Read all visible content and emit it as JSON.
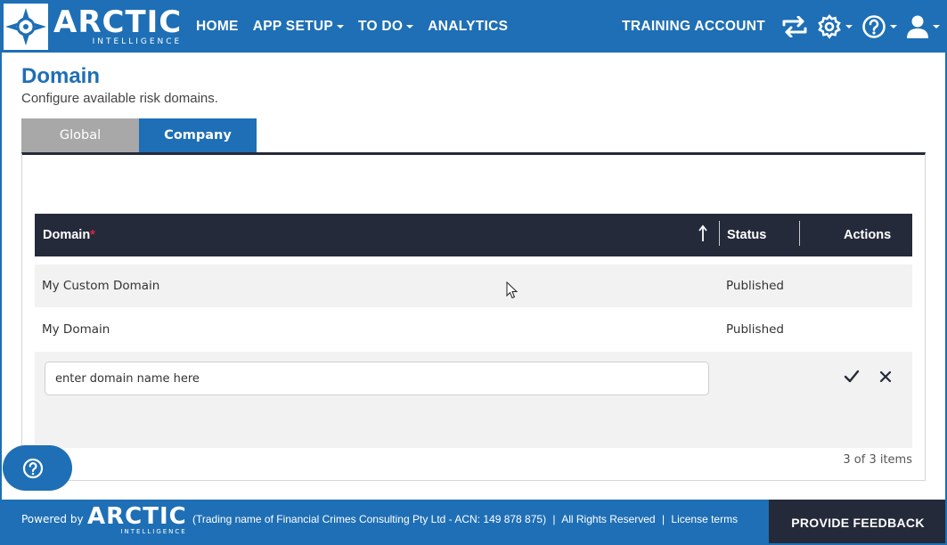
{
  "brand": {
    "name": "ARCTIC",
    "tagline": "INTELLIGENCE",
    "primary_color": "#1e6fb5",
    "dark_color": "#252a3a"
  },
  "nav": {
    "items": [
      {
        "label": "HOME",
        "has_dropdown": false
      },
      {
        "label": "APP SETUP",
        "has_dropdown": true
      },
      {
        "label": "TO DO",
        "has_dropdown": true
      },
      {
        "label": "ANALYTICS",
        "has_dropdown": false
      }
    ],
    "account_name": "TRAINING ACCOUNT",
    "icons": [
      "switch-account-icon",
      "gear-icon",
      "help-icon",
      "user-icon"
    ]
  },
  "page": {
    "title": "Domain",
    "subtitle": "Configure available risk domains."
  },
  "tabs": [
    {
      "label": "Global",
      "active": false
    },
    {
      "label": "Company",
      "active": true
    }
  ],
  "grid": {
    "columns": {
      "domain": "Domain",
      "domain_required_mark": "*",
      "status": "Status",
      "actions": "Actions"
    },
    "rows": [
      {
        "domain": "My Custom Domain",
        "status": "Published"
      },
      {
        "domain": "My Domain",
        "status": "Published"
      }
    ],
    "new_row": {
      "placeholder": "enter domain name here",
      "value": ""
    },
    "pager_info": "3 of 3 items"
  },
  "footer": {
    "powered_by": "Powered by",
    "legal": "(Trading name of Financial Crimes Consulting Pty Ltd - ACN: 149 878 875)",
    "sep": "|",
    "rights": "All Rights Reserved",
    "license": "License terms",
    "feedback_button": "PROVIDE FEEDBACK"
  }
}
